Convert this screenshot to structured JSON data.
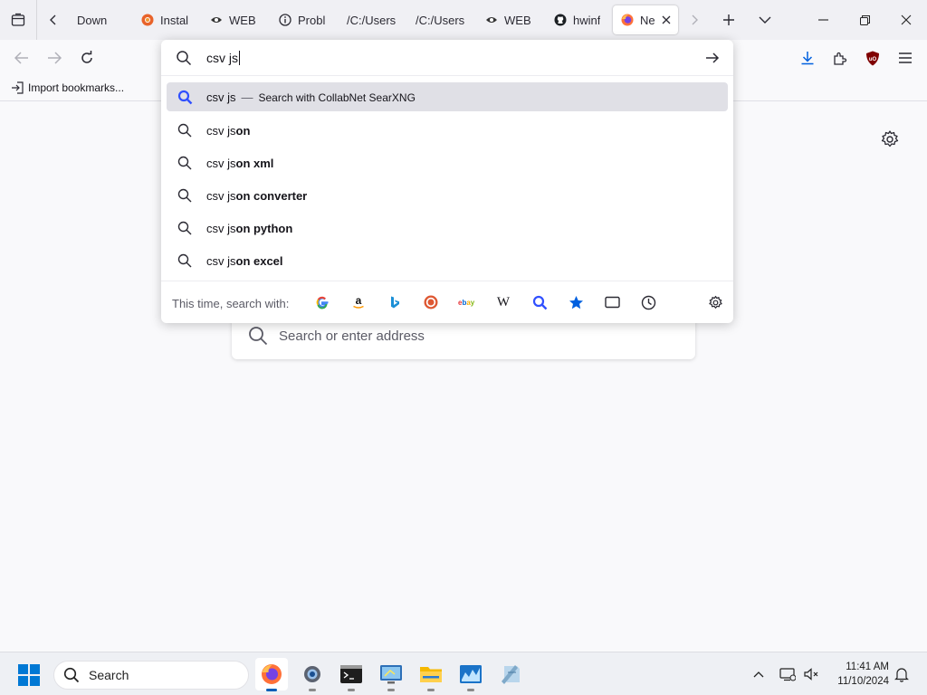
{
  "tabs": [
    {
      "label": "Down",
      "icon": "none"
    },
    {
      "label": "Instal",
      "icon": "chromium-icon"
    },
    {
      "label": "WEB",
      "icon": "eye-icon"
    },
    {
      "label": "Probl",
      "icon": "info-icon"
    },
    {
      "label": "/C:/Users",
      "icon": "none"
    },
    {
      "label": "/C:/Users",
      "icon": "none"
    },
    {
      "label": "WEB",
      "icon": "eye-icon"
    },
    {
      "label": "hwinf",
      "icon": "github-icon"
    },
    {
      "label": "Ne",
      "icon": "firefox-icon",
      "active": true
    }
  ],
  "bookmarks": {
    "import_label": "Import bookmarks..."
  },
  "urlbar": {
    "typed_text": "csv js",
    "selected_suggestion": {
      "query": "csv js",
      "action": "Search with CollabNet SearXNG"
    },
    "suggestions": [
      {
        "prefix": "csv js",
        "bold": "on"
      },
      {
        "prefix": "csv js",
        "bold": "on xml"
      },
      {
        "prefix": "csv js",
        "bold": "on converter"
      },
      {
        "prefix": "csv js",
        "bold": "on python"
      },
      {
        "prefix": "csv js",
        "bold": "on excel"
      }
    ],
    "oneoff_label": "This time, search with:",
    "engines": [
      "google-icon",
      "amazon-icon",
      "bing-icon",
      "duckduckgo-icon",
      "ebay-icon",
      "wikipedia-icon",
      "searxng-icon",
      "bookmarks-icon",
      "tabs-icon",
      "history-icon"
    ]
  },
  "page": {
    "search_placeholder": "Search or enter address"
  },
  "taskbar": {
    "search_label": "Search",
    "time": "11:41 AM",
    "date": "11/10/2024",
    "apps": [
      "firefox-icon",
      "settings-icon",
      "terminal-icon",
      "remote-desktop-icon",
      "file-explorer-icon",
      "monitor-app-icon",
      "notepad-icon"
    ]
  },
  "colors": {
    "accent": "#0060df",
    "selected_row": "#e0e0e6",
    "taskbar_active": "#005fb8"
  }
}
